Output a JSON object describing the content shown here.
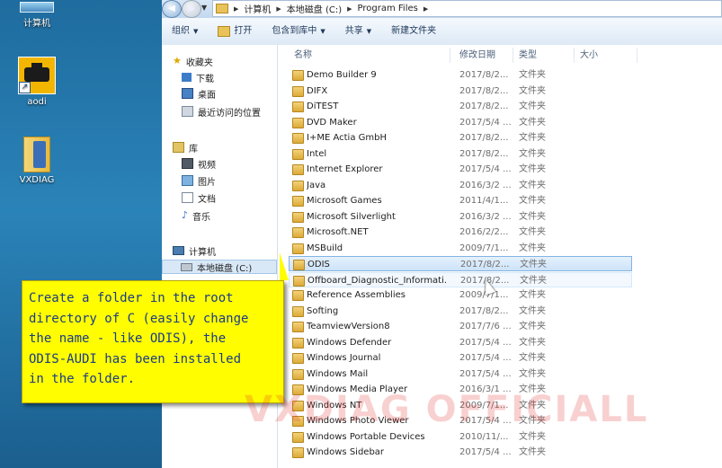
{
  "desktop": {
    "icons": [
      {
        "label": "计算机",
        "icon": "computer-icon"
      },
      {
        "label": "aodi",
        "icon": "engine-check-icon"
      },
      {
        "label": "VXDIAG",
        "icon": "folder-icon"
      }
    ]
  },
  "address": {
    "breadcrumbs": [
      "计算机",
      "本地磁盘 (C:)",
      "Program Files"
    ]
  },
  "toolbar": {
    "organize": "组织",
    "open": "打开",
    "include_in_library": "包含到库中",
    "share": "共享",
    "new_folder": "新建文件夹"
  },
  "navpane": {
    "favorites": "收藏夹",
    "downloads": "下载",
    "desktop": "桌面",
    "recent": "最近访问的位置",
    "libraries": "库",
    "videos": "视频",
    "pictures": "图片",
    "documents": "文档",
    "music": "音乐",
    "computer": "计算机",
    "local_disk": "本地磁盘 (C:)"
  },
  "columns": {
    "name": "名称",
    "date": "修改日期",
    "type": "类型",
    "size": "大小"
  },
  "files": [
    {
      "name": "Demo Builder 9",
      "date": "2017/8/2...",
      "type": "文件夹"
    },
    {
      "name": "DIFX",
      "date": "2017/8/2...",
      "type": "文件夹"
    },
    {
      "name": "DiTEST",
      "date": "2017/8/2...",
      "type": "文件夹"
    },
    {
      "name": "DVD Maker",
      "date": "2017/5/4 ...",
      "type": "文件夹"
    },
    {
      "name": "I+ME Actia GmbH",
      "date": "2017/8/2...",
      "type": "文件夹"
    },
    {
      "name": "Intel",
      "date": "2017/8/2...",
      "type": "文件夹"
    },
    {
      "name": "Internet Explorer",
      "date": "2017/5/4 ...",
      "type": "文件夹"
    },
    {
      "name": "Java",
      "date": "2016/3/2 ...",
      "type": "文件夹"
    },
    {
      "name": "Microsoft Games",
      "date": "2011/4/1...",
      "type": "文件夹"
    },
    {
      "name": "Microsoft Silverlight",
      "date": "2016/3/2 ...",
      "type": "文件夹"
    },
    {
      "name": "Microsoft.NET",
      "date": "2016/2/2...",
      "type": "文件夹"
    },
    {
      "name": "MSBuild",
      "date": "2009/7/1...",
      "type": "文件夹"
    },
    {
      "name": "ODIS",
      "date": "2017/8/2...",
      "type": "文件夹"
    },
    {
      "name": "Offboard_Diagnostic_Informati...",
      "date": "2017/8/2...",
      "type": "文件夹"
    },
    {
      "name": "Reference Assemblies",
      "date": "2009/7/1...",
      "type": "文件夹"
    },
    {
      "name": "Softing",
      "date": "2017/8/2...",
      "type": "文件夹"
    },
    {
      "name": "TeamviewVersion8",
      "date": "2017/7/6 ...",
      "type": "文件夹"
    },
    {
      "name": "Windows Defender",
      "date": "2017/5/4 ...",
      "type": "文件夹"
    },
    {
      "name": "Windows Journal",
      "date": "2017/5/4 ...",
      "type": "文件夹"
    },
    {
      "name": "Windows Mail",
      "date": "2017/5/4 ...",
      "type": "文件夹"
    },
    {
      "name": "Windows Media Player",
      "date": "2016/3/1 ...",
      "type": "文件夹"
    },
    {
      "name": "Windows NT",
      "date": "2009/7/1...",
      "type": "文件夹"
    },
    {
      "name": "Windows Photo Viewer",
      "date": "2017/5/4 ...",
      "type": "文件夹"
    },
    {
      "name": "Windows Portable Devices",
      "date": "2010/11/...",
      "type": "文件夹"
    },
    {
      "name": "Windows Sidebar",
      "date": "2017/5/4 ...",
      "type": "文件夹"
    }
  ],
  "selected_file": "ODIS",
  "hovered_file": "Offboard_Diagnostic_Informati...",
  "annotation": {
    "text": "Create a folder in the root\ndirectory of C (easily change\nthe name - like ODIS), the\nODIS-AUDI has been installed\nin the folder."
  },
  "watermark": "VXDIAG OFFICIALL",
  "colors": {
    "annotation_bg": "#fffd00",
    "annotation_text": "#1a3c86",
    "selection": "#cde3f9",
    "watermark": "#de2828"
  }
}
